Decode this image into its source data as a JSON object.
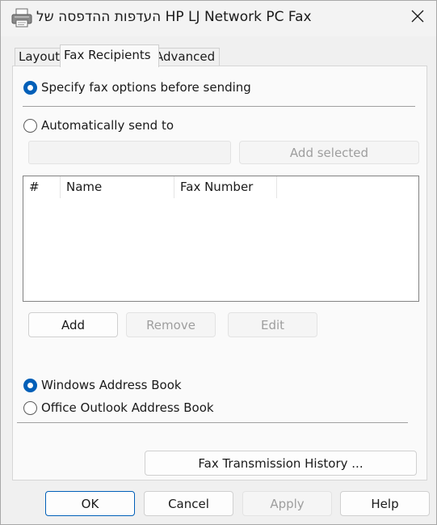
{
  "window": {
    "title": "העדפות ההדפסה של HP LJ Network PC Fax"
  },
  "tabs": [
    {
      "label": "Layout",
      "active": false
    },
    {
      "label": "Fax Recipients",
      "active": true
    },
    {
      "label": "Advanced",
      "active": false
    }
  ],
  "send_options": {
    "specify_label": "Specify fax options before sending",
    "specify_selected": true,
    "auto_label": "Automatically send to",
    "auto_selected": false,
    "recipient_input_value": "",
    "add_selected_label": "Add selected"
  },
  "recipients_table": {
    "columns": [
      "#",
      "Name",
      "Fax Number"
    ],
    "rows": []
  },
  "list_buttons": {
    "add": "Add",
    "remove": "Remove",
    "edit": "Edit"
  },
  "address_book": {
    "windows_label": "Windows Address Book",
    "windows_selected": true,
    "outlook_label": "Office Outlook Address Book",
    "outlook_selected": false
  },
  "history_button": "Fax Transmission History ...",
  "dialog_buttons": {
    "ok": "OK",
    "cancel": "Cancel",
    "apply": "Apply",
    "help": "Help"
  },
  "colors": {
    "accent": "#005fb8",
    "disabled_text": "#9e9e9e"
  }
}
